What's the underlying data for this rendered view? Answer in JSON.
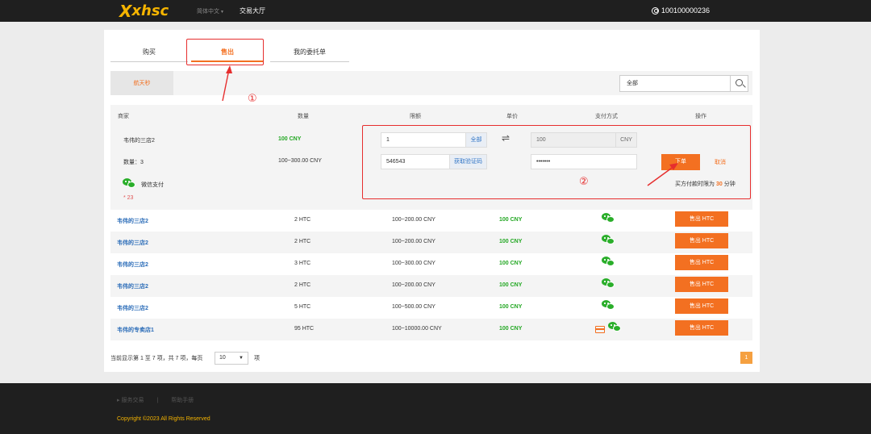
{
  "topbar": {
    "logo_mark": "X",
    "logo_text": "xhsc",
    "language": "简体中文",
    "nav_hall": "交易大厅",
    "user_id": "100100000236"
  },
  "tabs": [
    {
      "label": "购买",
      "active": false
    },
    {
      "label": "售出",
      "active": true
    },
    {
      "label": "我的委托单",
      "active": false
    }
  ],
  "annotations": {
    "one": "①",
    "two": "②"
  },
  "filter": {
    "coin_tab": "航天秒",
    "search_value": "全部"
  },
  "table": {
    "headers": [
      "商家",
      "数量",
      "限额",
      "单价",
      "支付方式",
      "操作"
    ]
  },
  "expanded": {
    "merchant": "韦伟的三店2",
    "price": "100 CNY",
    "quantity": "数量：3",
    "limit": "100~300.00 CNY",
    "payment_label": "微信支付",
    "note": "* 23",
    "amount_value": "1",
    "amount_all": "全部",
    "swap": "⇌",
    "total_value": "100",
    "total_unit": "CNY",
    "code_value": "546543",
    "code_button": "获取验证码",
    "password_value": "•••••••",
    "order_button": "下单",
    "cancel": "取消",
    "limit_prefix": "买方付款时限为",
    "limit_minutes": "30",
    "limit_suffix": "分钟"
  },
  "rows": [
    {
      "merchant": "韦伟的三店2",
      "amount": "2 HTC",
      "limit": "100~200.00 CNY",
      "price": "100 CNY",
      "pay": [
        "wechat"
      ],
      "action": "售出 HTC"
    },
    {
      "merchant": "韦伟的三店2",
      "amount": "2 HTC",
      "limit": "100~200.00 CNY",
      "price": "100 CNY",
      "pay": [
        "wechat"
      ],
      "action": "售出 HTC"
    },
    {
      "merchant": "韦伟的三店2",
      "amount": "3 HTC",
      "limit": "100~300.00 CNY",
      "price": "100 CNY",
      "pay": [
        "wechat"
      ],
      "action": "售出 HTC"
    },
    {
      "merchant": "韦伟的三店2",
      "amount": "2 HTC",
      "limit": "100~200.00 CNY",
      "price": "100 CNY",
      "pay": [
        "wechat"
      ],
      "action": "售出 HTC"
    },
    {
      "merchant": "韦伟的三店2",
      "amount": "5 HTC",
      "limit": "100~500.00 CNY",
      "price": "100 CNY",
      "pay": [
        "wechat"
      ],
      "action": "售出 HTC"
    },
    {
      "merchant": "韦伟的专卖店1",
      "amount": "95 HTC",
      "limit": "100~10000.00 CNY",
      "price": "100 CNY",
      "pay": [
        "card",
        "wechat"
      ],
      "action": "售出 HTC"
    }
  ],
  "pager": {
    "summary": "当前显示第 1 至 7 项，共 7 项，每页",
    "page_size": "10",
    "items_suffix": "项",
    "current_page": "1"
  },
  "footer": {
    "links": [
      "▸ 服务交易",
      "|",
      "帮助手册"
    ],
    "copyright": "Copyright ©2023 All Rights Reserved"
  },
  "colors": {
    "accent": "#f37021",
    "price_green": "#22a722",
    "annotation_red": "#e62e2e",
    "dark_bar": "#1f1f1f",
    "logo_gold": "#f5b400"
  }
}
